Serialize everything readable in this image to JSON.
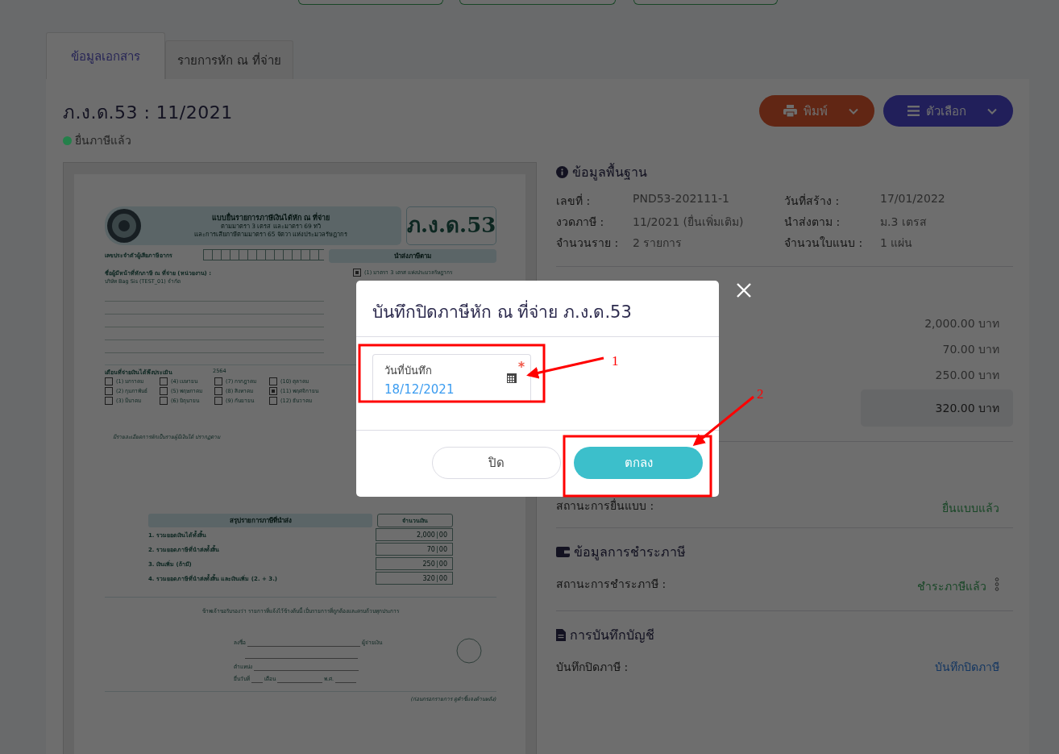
{
  "tabs": [
    {
      "label": "ข้อมูลเอกสาร",
      "selected": true
    },
    {
      "label": "รายการหัก ณ ที่จ่าย",
      "selected": false
    }
  ],
  "document": {
    "title": "ภ.ง.ด.53 : 11/2021",
    "status": {
      "label": "ยื่นภาษีแล้ว",
      "color": "#24804a"
    }
  },
  "actions": [
    {
      "kind": "print",
      "label": "พิมพ์"
    },
    {
      "kind": "options",
      "label": "ตัวเลือก"
    }
  ],
  "form_preview": {
    "header": [
      "แบบยื่นรายการภาษีเงินได้หัก ณ ที่จ่าย",
      "ตามมาตรา 3 เตรส และมาตรา 69 ทวิ",
      "และการเสียภาษีตามมาตรา 65 จัตวา แห่งประมวลรัษฎากร"
    ],
    "form_code": "ภ.ง.ด.53",
    "tax_id_label": "เลขประจำตัวผู้เสียภาษีอากร",
    "submit_heading": "นำส่งภาษีตาม",
    "submit_options": [
      {
        "label": "(1) มาตรา 3 เตรส แห่งประมวลรัษฎากร",
        "checked": true
      }
    ],
    "payer_label": "ชื่อผู้มีหน้าที่หักภาษี ณ ที่จ่าย (หน่วยงาน) :",
    "payer_name": "บริษัท Bag Sis (TEST_01) จำกัด",
    "month_label": "เดือนที่จ่ายเงินได้พึงประเมิน",
    "year": "2564",
    "months": [
      {
        "label": "(1) มกราคม",
        "checked": false
      },
      {
        "label": "(2) กุมภาพันธ์",
        "checked": false
      },
      {
        "label": "(3) มีนาคม",
        "checked": false
      },
      {
        "label": "(4) เมษายน",
        "checked": false
      },
      {
        "label": "(5) พฤษภาคม",
        "checked": false
      },
      {
        "label": "(6) มิถุนายน",
        "checked": false
      },
      {
        "label": "(7) กรกฎาคม",
        "checked": false
      },
      {
        "label": "(8) สิงหาคม",
        "checked": false
      },
      {
        "label": "(9) กันยายน",
        "checked": false
      },
      {
        "label": "(10) ตุลาคม",
        "checked": false
      },
      {
        "label": "(11) พฤศจิกายน",
        "checked": true
      },
      {
        "label": "(12) ธันวาคม",
        "checked": false
      }
    ],
    "detail_note": "มีรายละเอียดการหักเป็นรายผู้มีเงินได้ ปรากฏตาม",
    "summary_heading": "สรุปรายการภาษีที่นำส่ง",
    "amount_heading": "จำนวนเงิน",
    "summary_rows": [
      {
        "label": "1. รวมยอดเงินได้ทั้งสิ้น",
        "baht": "2,000",
        "satang": "00"
      },
      {
        "label": "2. รวมยอดภาษีที่นำส่งทั้งสิ้น",
        "baht": "70",
        "satang": "00"
      },
      {
        "label": "3. เงินเพิ่ม (ถ้ามี)",
        "baht": "250",
        "satang": "00"
      },
      {
        "label": "4. รวมยอดภาษีที่นำส่งทั้งสิ้น และเงินเพิ่ม (2. + 3.)",
        "baht": "320",
        "satang": "00"
      }
    ],
    "certification": "ข้าพเจ้าขอรับรองว่า รายการที่แจ้งไว้ข้างต้นนี้ เป็นรายการที่ถูกต้องและครบถ้วนทุกประการ",
    "signature": {
      "sign": "ลงชื่อ",
      "payer": "ผู้จ่ายเงิน",
      "position": "ตำแหน่ง",
      "date": "ยื่นวันที่",
      "month": "เดือน",
      "year": "พ.ศ."
    },
    "footnote": "(ก่อนกรอกรายการ ดูคำชี้แจงด้านหลัง)"
  },
  "basic_info": {
    "heading": "ข้อมูลพื้นฐาน",
    "fields": [
      {
        "label": "เลขที่ :",
        "value": "PND53-202111-1"
      },
      {
        "label": "วันที่สร้าง :",
        "value": "17/01/2022"
      },
      {
        "label": "งวดภาษี :",
        "value": "11/2021 (ยื่นเพิ่มเติม)"
      },
      {
        "label": "นำส่งตาม :",
        "value": "ม.3 เตรส"
      },
      {
        "label": "จำนวนราย :",
        "value": "2 รายการ"
      },
      {
        "label": "จำนวนใบแนบ :",
        "value": "1 แผ่น"
      }
    ]
  },
  "amounts": [
    {
      "value": "2,000.00 บาท",
      "total": false
    },
    {
      "value": "70.00 บาท",
      "total": false
    },
    {
      "value": "250.00 บาท",
      "total": false
    },
    {
      "value": "320.00 บาท",
      "total": true
    }
  ],
  "filing_status": {
    "label": "สถานะการยื่นแบบ :",
    "value": "ยื่นแบบแล้ว",
    "kind": "status"
  },
  "payment": {
    "heading": "ข้อมูลการชำระภาษี",
    "rows": [
      {
        "label": "สถานะการชำระภาษี :",
        "value": "ชำระภาษีแล้ว",
        "kind": "status",
        "menu": true
      }
    ]
  },
  "accounting": {
    "heading": "การบันทึกบัญชี",
    "rows": [
      {
        "label": "บันทึกปิดภาษี :",
        "value": "บันทึกปิดภาษี",
        "kind": "link",
        "menu": false
      }
    ]
  },
  "dialog": {
    "title": "บันทึกปิดภาษีหัก ณ ที่จ่าย ภ.ง.ด.53",
    "field": {
      "label": "วันที่บันทึก",
      "value": "18/12/2021",
      "required": true
    },
    "buttons": [
      {
        "kind": "secondary",
        "label": "ปิด"
      },
      {
        "kind": "primary",
        "label": "ตกลง"
      }
    ]
  },
  "annotations": [
    {
      "label": "1"
    },
    {
      "label": "2"
    }
  ]
}
